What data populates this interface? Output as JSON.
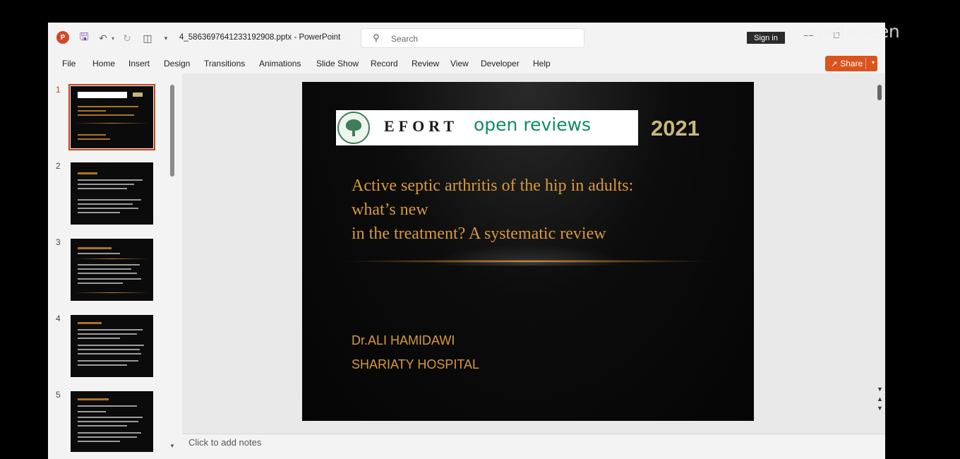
{
  "titlebar": {
    "file_title": "4_5863697641233192908.pptx  -  PowerPoint",
    "search_placeholder": "Search",
    "sign_in": "Sign in",
    "app_logo": "P"
  },
  "ribbon": {
    "tabs": [
      "File",
      "Home",
      "Insert",
      "Design",
      "Transitions",
      "Animations",
      "Slide Show",
      "Record",
      "Review",
      "View",
      "Developer",
      "Help"
    ],
    "share_label": "Share"
  },
  "thumbnails": {
    "numbers": [
      "1",
      "2",
      "3",
      "4",
      "5"
    ],
    "selected": 1
  },
  "slide": {
    "banner_efort": "EFORT",
    "banner_open": "open reviews",
    "year": "2021",
    "title": "Active septic arthritis of the hip in adults:\nwhat’s new\nin the treatment? A systematic review",
    "author": "Dr.ALI HAMIDAWI",
    "hospital": "SHARIATY HOSPITAL"
  },
  "notes": {
    "placeholder": "Click to add notes"
  },
  "watermark": "med+seen",
  "colors": {
    "accent": "#c43e1c",
    "share": "#d9541e",
    "slide_text": "#d99a3a",
    "year": "#c9b67c",
    "open_reviews_green": "#0f8a66"
  },
  "icons": [
    "powerpoint-logo-icon",
    "save-icon",
    "undo-icon",
    "redo-icon",
    "present-icon",
    "search-icon",
    "share-icon",
    "chevron-down-icon"
  ]
}
